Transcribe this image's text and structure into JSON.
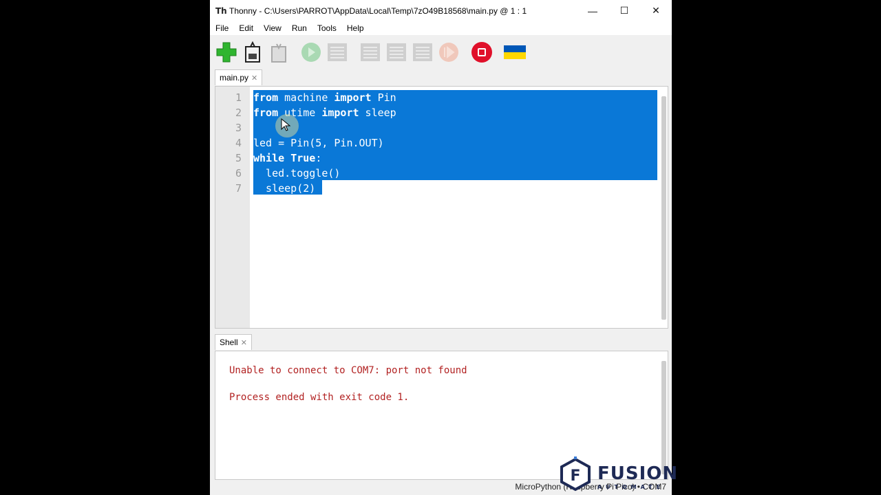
{
  "window": {
    "title": "Thonny  -  C:\\Users\\PARROT\\AppData\\Local\\Temp\\7zO49B18568\\main.py  @  1 : 1",
    "app_icon": "Th",
    "minimize_icon": "—",
    "maximize_icon": "☐",
    "close_icon": "✕"
  },
  "menu": [
    "File",
    "Edit",
    "View",
    "Run",
    "Tools",
    "Help"
  ],
  "toolbar": {
    "buttons": [
      {
        "name": "new-file",
        "enabled": true,
        "color": "#2fb52f"
      },
      {
        "name": "load-file",
        "enabled": true,
        "color": "#333333"
      },
      {
        "name": "save-file",
        "enabled": false,
        "color": "#9a9a9a"
      },
      {
        "name": "run",
        "enabled": false,
        "color": "#9ccfa6"
      },
      {
        "name": "debug",
        "enabled": false,
        "color": "#a8a8a8"
      },
      {
        "name": "step-over",
        "enabled": false,
        "color": "#a8a8a8"
      },
      {
        "name": "step-into",
        "enabled": false,
        "color": "#a8a8a8"
      },
      {
        "name": "step-out",
        "enabled": false,
        "color": "#a8a8a8"
      },
      {
        "name": "resume",
        "enabled": false,
        "color": "#e8b8a8"
      },
      {
        "name": "stop",
        "enabled": true,
        "color": "#e0102a"
      },
      {
        "name": "ukraine-flag",
        "enabled": true,
        "color": "#0057b7"
      }
    ]
  },
  "editor": {
    "tab_label": "main.py",
    "tab_close": "✕",
    "line_numbers": [
      "1",
      "2",
      "3",
      "4",
      "5",
      "6",
      "7"
    ],
    "lines": [
      {
        "kw": "from",
        "rest": " machine ",
        "kw2": "import",
        "rest2": " Pin"
      },
      {
        "kw": "from",
        "rest": " utime ",
        "kw2": "import",
        "rest2": " sleep"
      },
      {
        "kw": "",
        "rest": "",
        "kw2": "",
        "rest2": ""
      },
      {
        "kw": "",
        "rest": "led = Pin(5, Pin.OUT)",
        "kw2": "",
        "rest2": ""
      },
      {
        "kw": "while",
        "rest": " ",
        "kw2": "True",
        "rest2": ":"
      },
      {
        "kw": "",
        "rest": "  led.toggle()",
        "kw2": "",
        "rest2": ""
      },
      {
        "kw": "",
        "rest": "  sleep(2)",
        "kw2": "",
        "rest2": ""
      }
    ],
    "selection_color": "#0a78d7"
  },
  "shell": {
    "tab_label": "Shell",
    "tab_close": "✕",
    "lines": [
      "Unable to connect to COM7: port not found",
      "Process ended with exit code 1."
    ],
    "error_color": "#b22222"
  },
  "status": {
    "interpreter": "MicroPython (Raspberry Pi Pico)  •  COM7"
  },
  "watermark": {
    "brand": "FUSION",
    "sub": "AUTOMATE",
    "logo_letter": "F"
  }
}
